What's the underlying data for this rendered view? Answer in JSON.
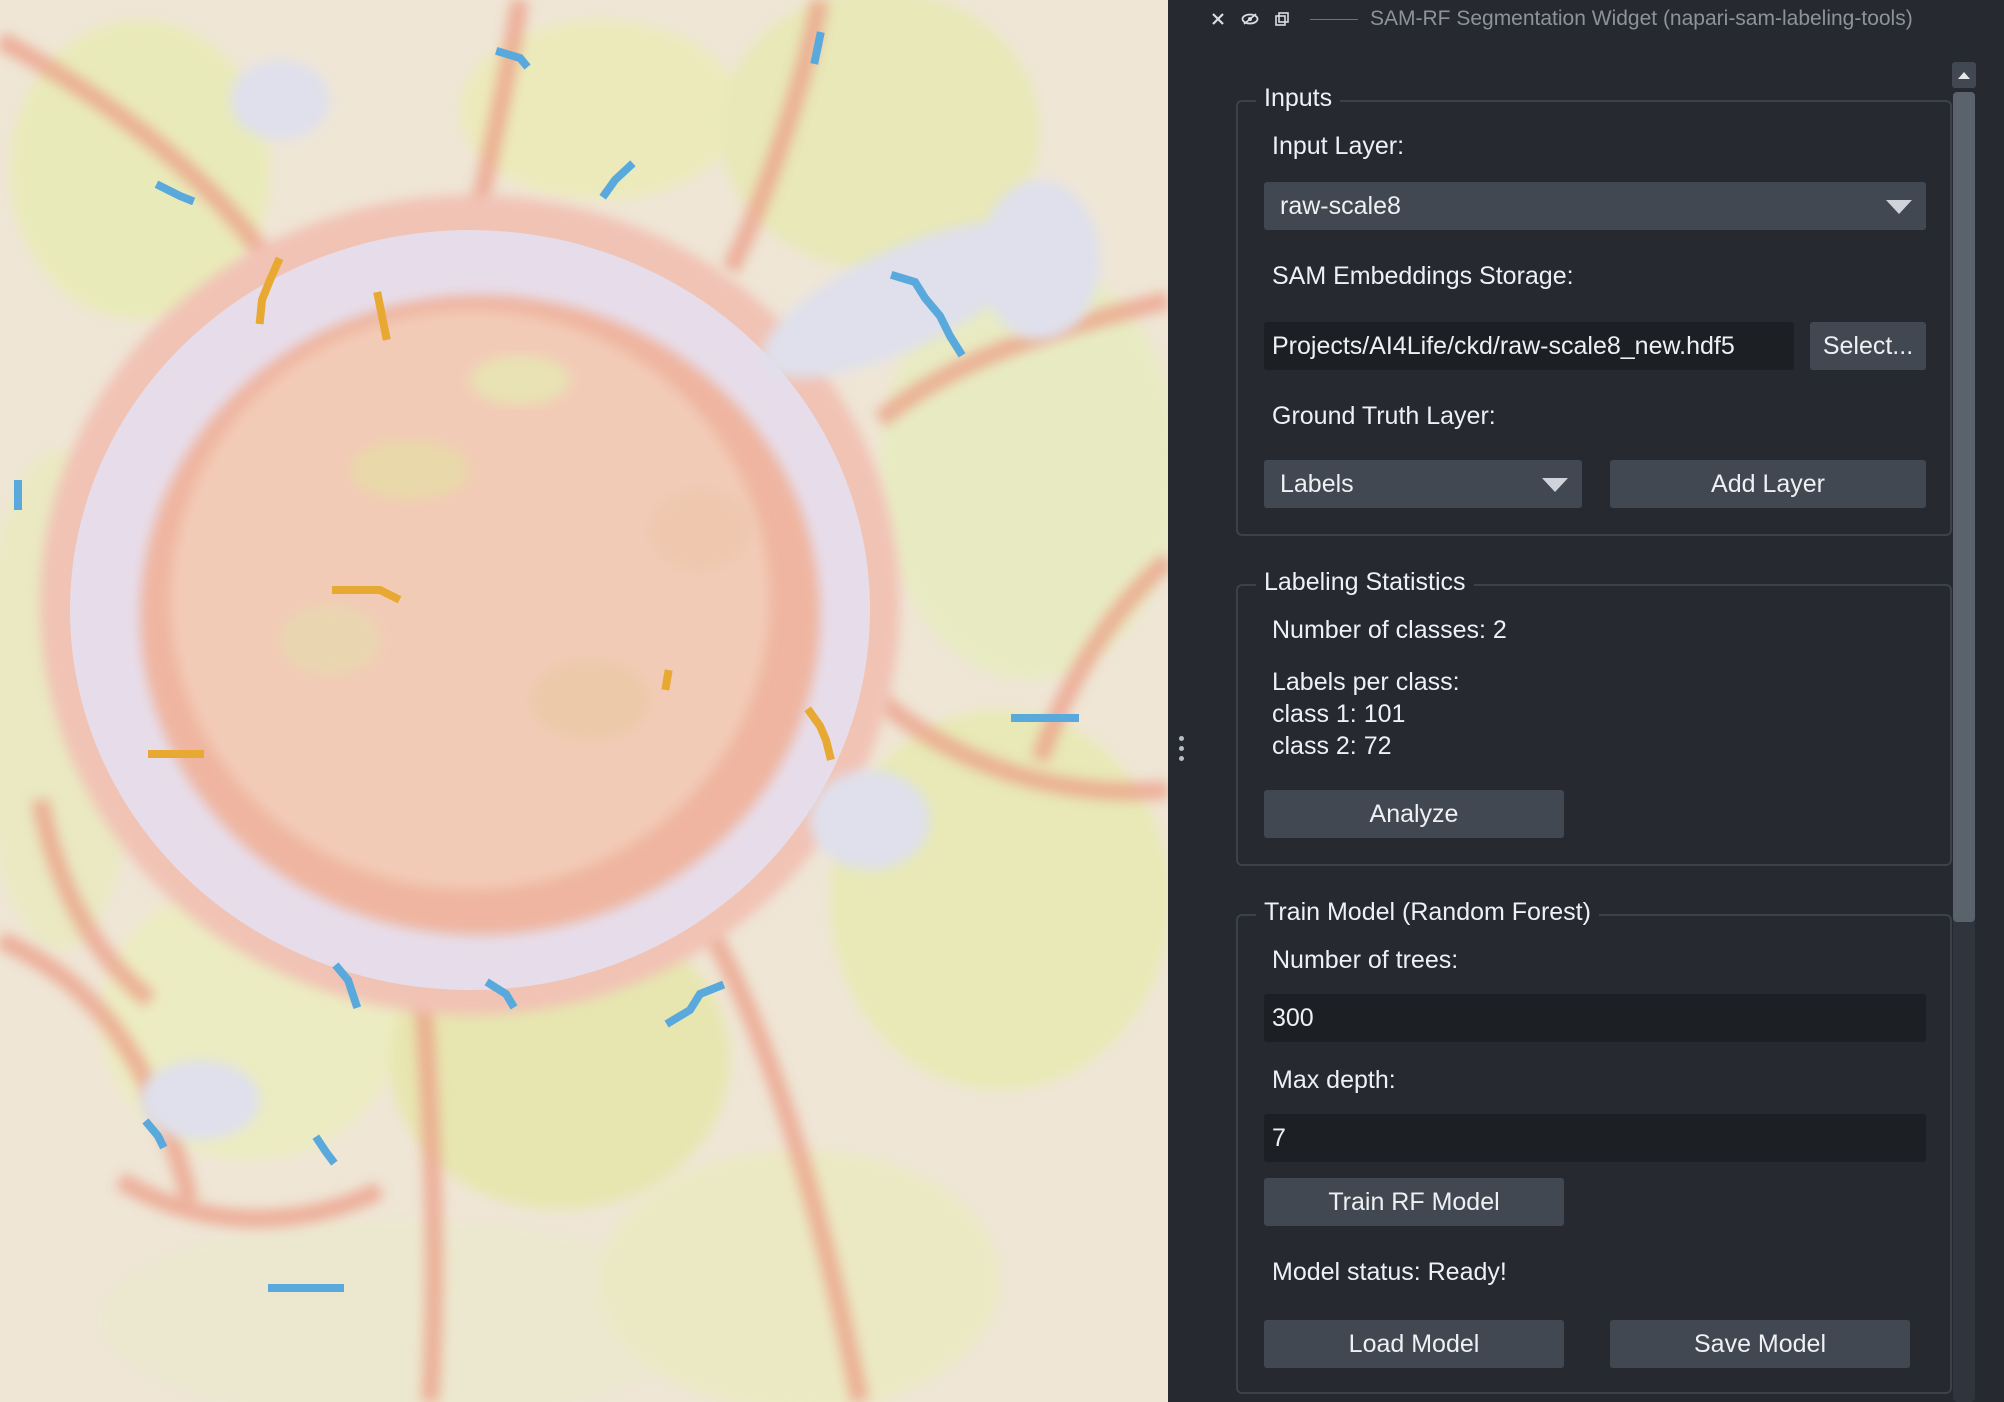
{
  "dock": {
    "title": "SAM-RF Segmentation Widget (napari-sam-labeling-tools)",
    "close_icon": "close-icon",
    "float_icon": "eye-icon",
    "detach_icon": "detach-icon"
  },
  "inputs": {
    "group_title": "Inputs",
    "input_layer_label": "Input Layer:",
    "input_layer_value": "raw-scale8",
    "storage_label": "SAM Embeddings Storage:",
    "storage_path": "Projects/AI4Life/ckd/raw-scale8_new.hdf5",
    "select_button": "Select...",
    "gt_label": "Ground Truth Layer:",
    "gt_value": "Labels",
    "add_layer_button": "Add Layer"
  },
  "stats": {
    "group_title": "Labeling Statistics",
    "num_classes": "Number of classes: 2",
    "labels_per_class": "Labels per class:",
    "class1": "class 1: 101",
    "class2": "class 2: 72",
    "analyze_button": "Analyze"
  },
  "train": {
    "group_title": "Train Model (Random Forest)",
    "trees_label": "Number of trees:",
    "trees_value": "300",
    "depth_label": "Max depth:",
    "depth_value": "7",
    "train_button": "Train RF Model",
    "status": "Model status: Ready!",
    "load_button": "Load Model",
    "save_button": "Save Model"
  },
  "colors": {
    "panel_bg": "#262930",
    "control_bg": "#414851",
    "field_bg": "#1c1f24",
    "label_class1": "#5aa9dc",
    "label_class2": "#e8a932"
  }
}
